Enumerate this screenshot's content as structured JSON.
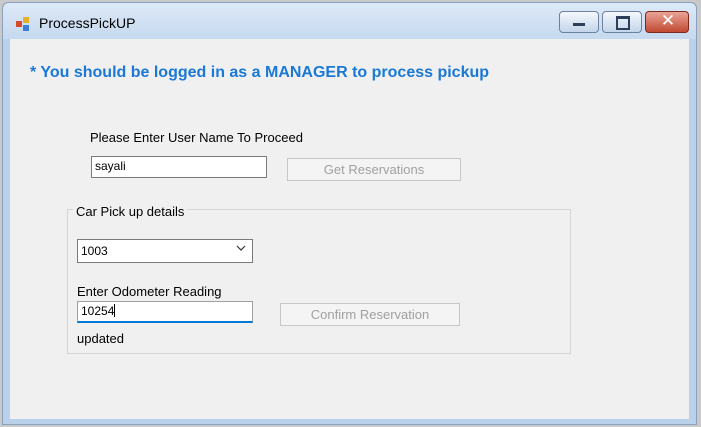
{
  "window": {
    "title": "ProcessPickUP",
    "icon": "app-icon",
    "controls": [
      "minimize-icon",
      "maximize-icon",
      "close-icon"
    ]
  },
  "form": {
    "warning": "* You should be logged in as a MANAGER to process pickup",
    "username_label": "Please Enter User Name To Proceed",
    "username_value": "sayali",
    "get_reservations_label": "Get Reservations",
    "group_title": "Car Pick up details",
    "car_select_value": "1003",
    "odometer_label": "Enter Odometer Reading",
    "odometer_value": "10254",
    "confirm_label": "Confirm Reservation",
    "status_text": "updated"
  },
  "colors": {
    "accent": "#1a78d6",
    "focus_underline": "#0078d7",
    "disabled_text": "#a0a0a0"
  }
}
